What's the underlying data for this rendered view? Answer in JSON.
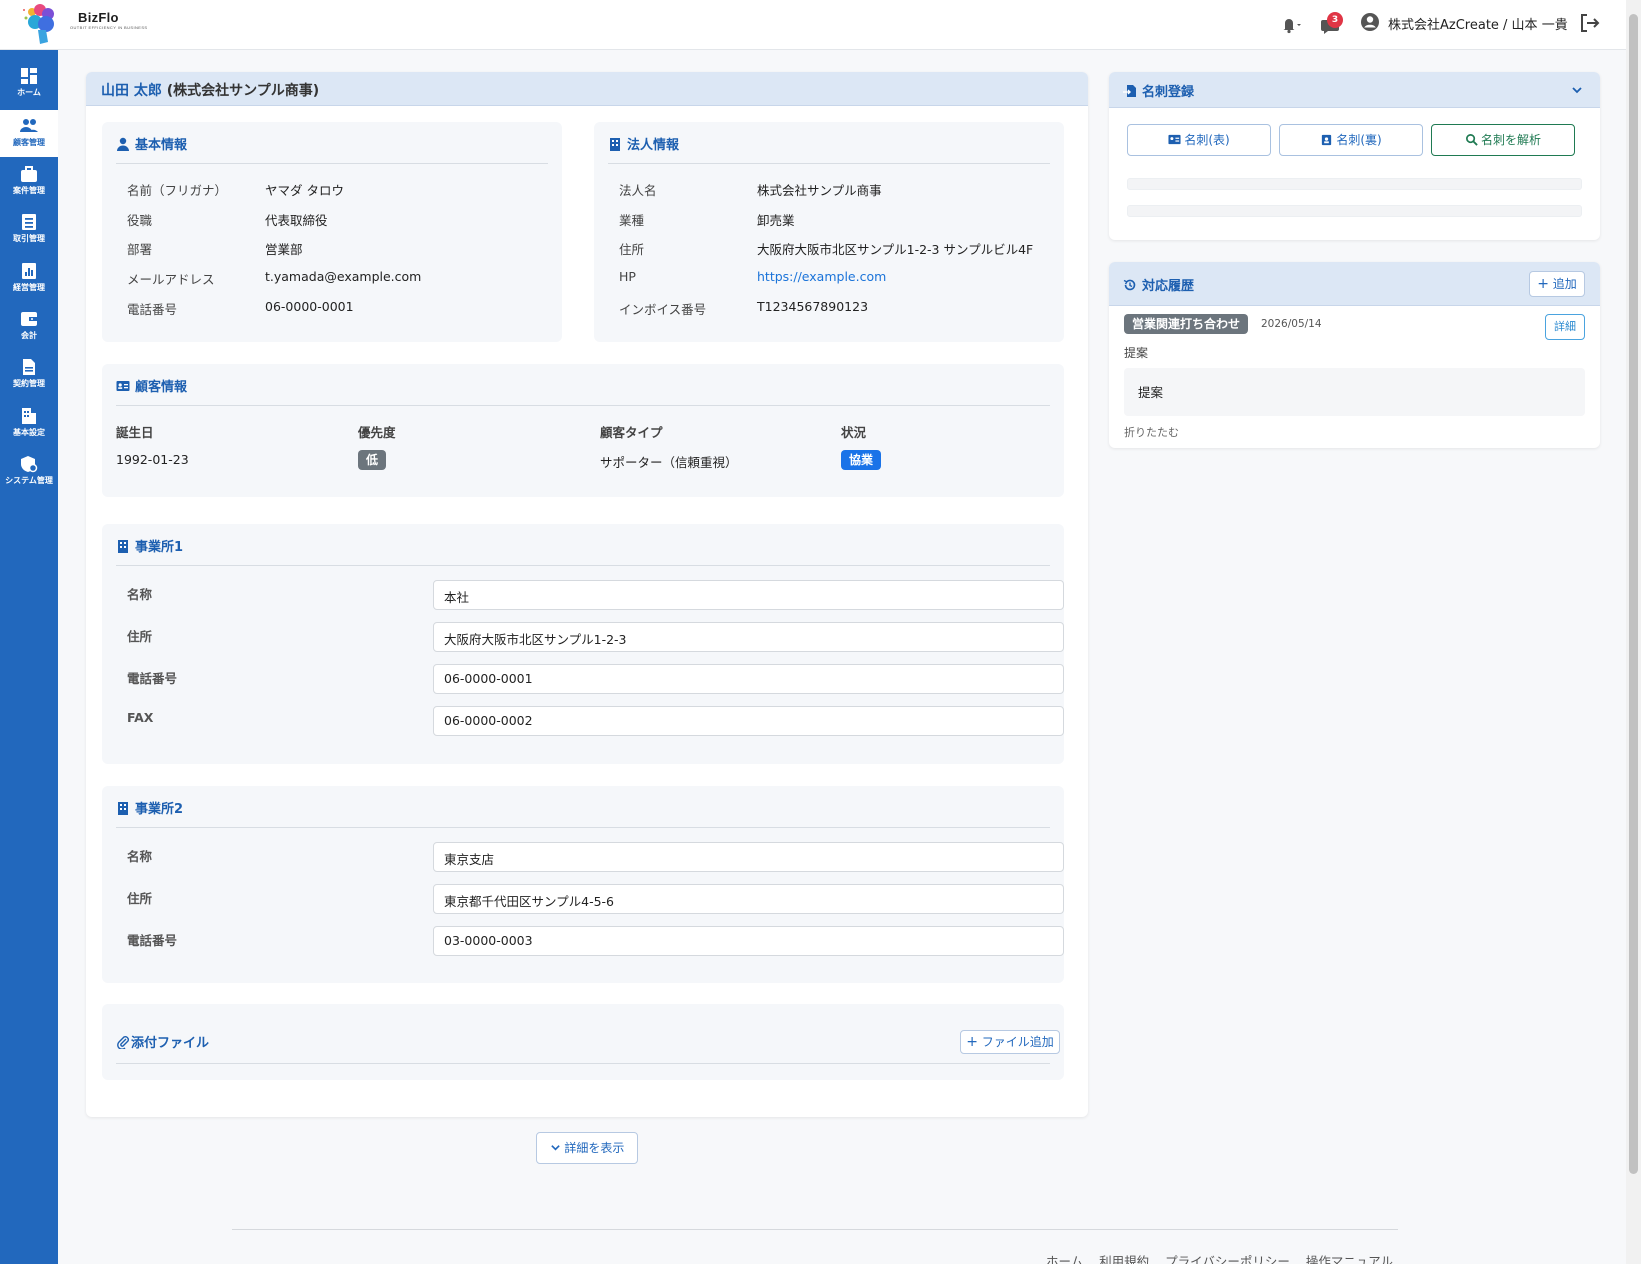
{
  "header": {
    "app_name": "BizFlo",
    "tagline": "OUTBIT EFFICIENCY IN BUSINESS",
    "notification_count": "3",
    "user_label": "株式会社AzCreate / 山本 一貴"
  },
  "sidebar": {
    "items": [
      {
        "label": "ホーム",
        "icon": "dashboard-icon"
      },
      {
        "label": "顧客管理",
        "icon": "users-icon"
      },
      {
        "label": "案件管理",
        "icon": "briefcase-icon"
      },
      {
        "label": "取引管理",
        "icon": "receipt-icon"
      },
      {
        "label": "経営管理",
        "icon": "chart-icon"
      },
      {
        "label": "会計",
        "icon": "wallet-icon"
      },
      {
        "label": "契約管理",
        "icon": "document-icon"
      },
      {
        "label": "基本設定",
        "icon": "building-icon"
      },
      {
        "label": "システム管理",
        "icon": "shield-gear-icon"
      }
    ]
  },
  "page": {
    "name": "山田 太郎",
    "company": "(株式会社サンプル商事)"
  },
  "basic_info": {
    "title": "基本情報",
    "rows": [
      {
        "label": "名前（フリガナ）",
        "value": "ヤマダ タロウ"
      },
      {
        "label": "役職",
        "value": "代表取締役"
      },
      {
        "label": "部署",
        "value": "営業部"
      },
      {
        "label": "メールアドレス",
        "value": "t.yamada@example.com"
      },
      {
        "label": "電話番号",
        "value": "06-0000-0001"
      }
    ]
  },
  "corp_info": {
    "title": "法人情報",
    "rows": [
      {
        "label": "法人名",
        "value": "株式会社サンプル商事"
      },
      {
        "label": "業種",
        "value": "卸売業"
      },
      {
        "label": "住所",
        "value": "大阪府大阪市北区サンプル1-2-3 サンプルビル4F"
      },
      {
        "label": "HP",
        "value": "https://example.com"
      },
      {
        "label": "インボイス番号",
        "value": "T1234567890123"
      }
    ]
  },
  "customer_info": {
    "title": "顧客情報",
    "birthday_label": "誕生日",
    "birthday": "1992-01-23",
    "priority_label": "優先度",
    "priority": "低",
    "type_label": "顧客タイプ",
    "type": "サポーター（信頼重視）",
    "status_label": "状況",
    "status": "協業",
    "priority_color": "#6c757d",
    "status_color": "#1a73e8"
  },
  "office1": {
    "title": "事業所1",
    "fields": [
      {
        "label": "名称",
        "value": "本社"
      },
      {
        "label": "住所",
        "value": "大阪府大阪市北区サンプル1-2-3"
      },
      {
        "label": "電話番号",
        "value": "06-0000-0001"
      },
      {
        "label": "FAX",
        "value": "06-0000-0002"
      }
    ]
  },
  "office2": {
    "title": "事業所2",
    "fields": [
      {
        "label": "名称",
        "value": "東京支店"
      },
      {
        "label": "住所",
        "value": "東京都千代田区サンプル4-5-6"
      },
      {
        "label": "電話番号",
        "value": "03-0000-0003"
      }
    ]
  },
  "attachments": {
    "title": "添付ファイル",
    "add_label": "ファイル追加"
  },
  "show_details_label": "詳細を表示",
  "business_card": {
    "title": "名刺登録",
    "front_label": "名刺(表)",
    "back_label": "名刺(裏)",
    "analyze_label": "名刺を解析"
  },
  "history": {
    "title": "対応履歴",
    "add_label": "追加",
    "entries": [
      {
        "tag": "営業関連打ち合わせ",
        "date": "2026/05/14",
        "detail_label": "詳細",
        "summary": "提案",
        "body": "提案",
        "collapse_label": "折りたたむ"
      }
    ]
  },
  "footer": {
    "links": [
      "ホーム",
      "利用規約",
      "プライバシーポリシー",
      "操作マニュアル"
    ]
  },
  "colors": {
    "brand": "#2268bd",
    "accent_blue": "#1d5fb0"
  }
}
